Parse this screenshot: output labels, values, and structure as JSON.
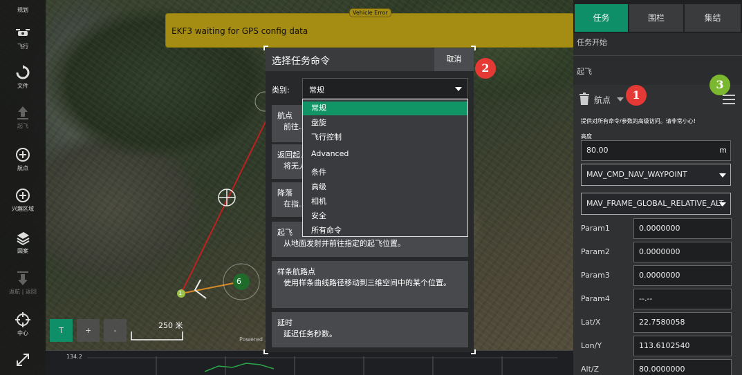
{
  "toolbar": {
    "items": [
      {
        "label": "规划",
        "icon": "plan-icon"
      },
      {
        "label": "飞行",
        "icon": "drone-icon"
      },
      {
        "label": "文件",
        "icon": "sync-icon"
      },
      {
        "label": "起飞",
        "icon": "takeoff-icon"
      },
      {
        "label": "航点",
        "icon": "add-waypoint-icon"
      },
      {
        "label": "兴趣区域",
        "icon": "add-roi-icon"
      },
      {
        "label": "図案",
        "icon": "pattern-icon"
      },
      {
        "label": "返航 | 返回",
        "icon": "return-icon"
      },
      {
        "label": "中心",
        "icon": "crosshair-icon"
      },
      {
        "label": "",
        "icon": "expand-icon"
      }
    ]
  },
  "vehicle_error": {
    "tag": "Vehicle Error",
    "message": "EKF3 waiting for GPS config data"
  },
  "dialog": {
    "title": "选择任务命令",
    "cancel": "取消",
    "category_label": "类别:",
    "category_value": "常规",
    "commands": [
      {
        "title": "航点",
        "desc": "前往..."
      },
      {
        "title": "返回起...",
        "desc": "将无人..."
      },
      {
        "title": "降落",
        "desc": "在指..."
      },
      {
        "title": "起飞",
        "desc": "从地面发射并前往指定的起飞位置。"
      },
      {
        "title": "样条航路点",
        "desc": "使用样条曲线路径移动到三维空间中的某个位置。"
      },
      {
        "title": "延时",
        "desc": "延迟任务秒数。"
      }
    ]
  },
  "dropdown": {
    "options": [
      "常规",
      "盘旋",
      "飞行控制",
      "Advanced",
      "条件",
      "高级",
      "相机",
      "安全",
      "所有命令"
    ],
    "selected_index": 0
  },
  "right_panel": {
    "tabs": [
      "任务",
      "围栏",
      "集结"
    ],
    "active_tab": 0,
    "mission_start": "任务开始",
    "takeoff": "起飞",
    "waypoint_label": "航点",
    "warning": "提供对所有命令/参数的高级访问。请非常小心!",
    "altitude_label": "高度",
    "altitude_value": "80.00",
    "altitude_unit": "m",
    "command_select": "MAV_CMD_NAV_WAYPOINT",
    "frame_select": "MAV_FRAME_GLOBAL_RELATIVE_ALT",
    "params": [
      {
        "label": "Param1",
        "value": "0.0000000"
      },
      {
        "label": "Param2",
        "value": "0.0000000"
      },
      {
        "label": "Param3",
        "value": "0.0000000"
      },
      {
        "label": "Param4",
        "value": "--.--"
      },
      {
        "label": "Lat/X",
        "value": "22.7580058"
      },
      {
        "label": "Lon/Y",
        "value": "113.6102540"
      },
      {
        "label": "Alt/Z",
        "value": "80.0000000"
      }
    ]
  },
  "badges": {
    "one": "1",
    "two": "2",
    "three": "3"
  },
  "map": {
    "scale": "250 米",
    "waypoint_marker": "6",
    "home_marker": "1",
    "zoom_t": "T",
    "zoom_plus": "+",
    "zoom_minus": "-",
    "powered": "Powered"
  },
  "chart": {
    "tick": "134.2"
  },
  "colors": {
    "accent": "#0f8f67",
    "error": "#a58c13",
    "badge_red": "#e53935",
    "badge_green": "#7cb82f"
  }
}
